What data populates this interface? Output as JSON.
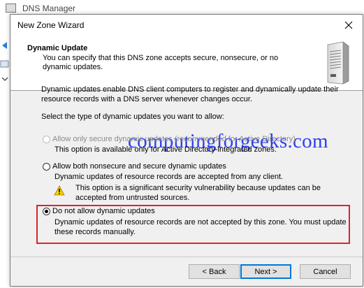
{
  "background_window": {
    "title": "DNS Manager"
  },
  "dialog": {
    "title": "New Zone Wizard",
    "close_glyph": "✕"
  },
  "header": {
    "title": "Dynamic Update",
    "description": "You can specify that this DNS zone accepts secure, nonsecure, or no dynamic updates.",
    "icon": "server-icon"
  },
  "body": {
    "intro": "Dynamic updates enable DNS client computers to register and dynamically update their resource records with a DNS server whenever changes occur.",
    "prompt": "Select the type of dynamic updates you want to allow:"
  },
  "options": [
    {
      "label": "Allow only secure dynamic updates (recommended for Active Directory)",
      "description": "This option is available only for Active Directory-integrated zones.",
      "enabled": false,
      "selected": false
    },
    {
      "label": "Allow both nonsecure and secure dynamic updates",
      "description": "Dynamic updates of resource records are accepted from any client.",
      "warning": "This option is a significant security vulnerability because updates can be accepted from untrusted sources.",
      "enabled": true,
      "selected": false
    },
    {
      "label": "Do not allow dynamic updates",
      "description": "Dynamic updates of resource records are not accepted by this zone. You must update these records manually.",
      "enabled": true,
      "selected": true
    }
  ],
  "watermark": "computingforgeeks.com",
  "buttons": {
    "back": "< Back",
    "next": "Next >",
    "cancel": "Cancel"
  },
  "colors": {
    "highlight_border": "#d9252b",
    "watermark": "#2d3ff0",
    "primary_button_border": "#0078d7"
  }
}
